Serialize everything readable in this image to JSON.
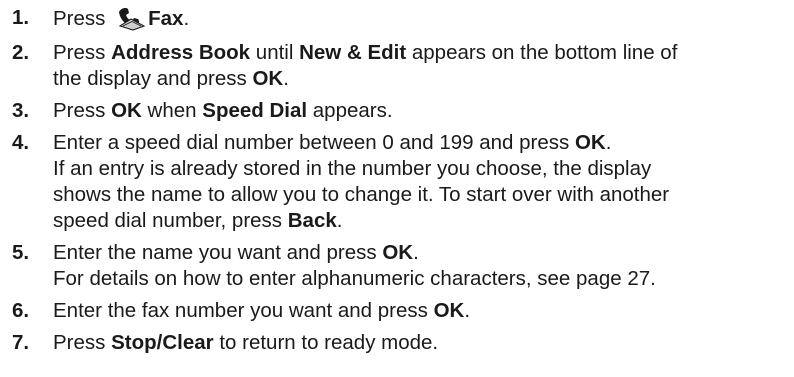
{
  "steps": [
    {
      "number": "1.",
      "parts": [
        {
          "t": "Press ",
          "b": false
        },
        {
          "icon": "fax-icon"
        },
        {
          "t": "Fax",
          "b": true
        },
        {
          "t": ".",
          "b": false
        }
      ]
    },
    {
      "number": "2.",
      "lines": [
        [
          {
            "t": "Press ",
            "b": false
          },
          {
            "t": "Address Book",
            "b": true
          },
          {
            "t": " until ",
            "b": false
          },
          {
            "t": "New & Edit",
            "b": true
          },
          {
            "t": " appears on the bottom line of",
            "b": false
          }
        ],
        [
          {
            "t": "the display and press ",
            "b": false
          },
          {
            "t": "OK",
            "b": true
          },
          {
            "t": ".",
            "b": false
          }
        ]
      ]
    },
    {
      "number": "3.",
      "lines": [
        [
          {
            "t": "Press ",
            "b": false
          },
          {
            "t": "OK",
            "b": true
          },
          {
            "t": " when ",
            "b": false
          },
          {
            "t": "Speed Dial",
            "b": true
          },
          {
            "t": " appears.",
            "b": false
          }
        ]
      ]
    },
    {
      "number": "4.",
      "lines": [
        [
          {
            "t": "Enter a speed dial number between 0 and 199 and press ",
            "b": false
          },
          {
            "t": "OK",
            "b": true
          },
          {
            "t": ".",
            "b": false
          }
        ],
        [
          {
            "t": "If an entry is already stored in the number you choose, the display",
            "b": false
          }
        ],
        [
          {
            "t": "shows the name to allow you to change it. To start over with another",
            "b": false
          }
        ],
        [
          {
            "t": "speed dial number, press ",
            "b": false
          },
          {
            "t": "Back",
            "b": true
          },
          {
            "t": ".",
            "b": false
          }
        ]
      ]
    },
    {
      "number": "5.",
      "lines": [
        [
          {
            "t": "Enter the name you want and press ",
            "b": false
          },
          {
            "t": "OK",
            "b": true
          },
          {
            "t": ".",
            "b": false
          }
        ],
        [
          {
            "t": "For details on how to enter alphanumeric characters, see page 27.",
            "b": false
          }
        ]
      ]
    },
    {
      "number": "6.",
      "lines": [
        [
          {
            "t": "Enter the fax number you want and press ",
            "b": false
          },
          {
            "t": "OK",
            "b": true
          },
          {
            "t": ".",
            "b": false
          }
        ]
      ]
    },
    {
      "number": "7.",
      "lines": [
        [
          {
            "t": "Press ",
            "b": false
          },
          {
            "t": "Stop/Clear",
            "b": true
          },
          {
            "t": " to return to ready mode.",
            "b": false
          }
        ]
      ]
    }
  ]
}
